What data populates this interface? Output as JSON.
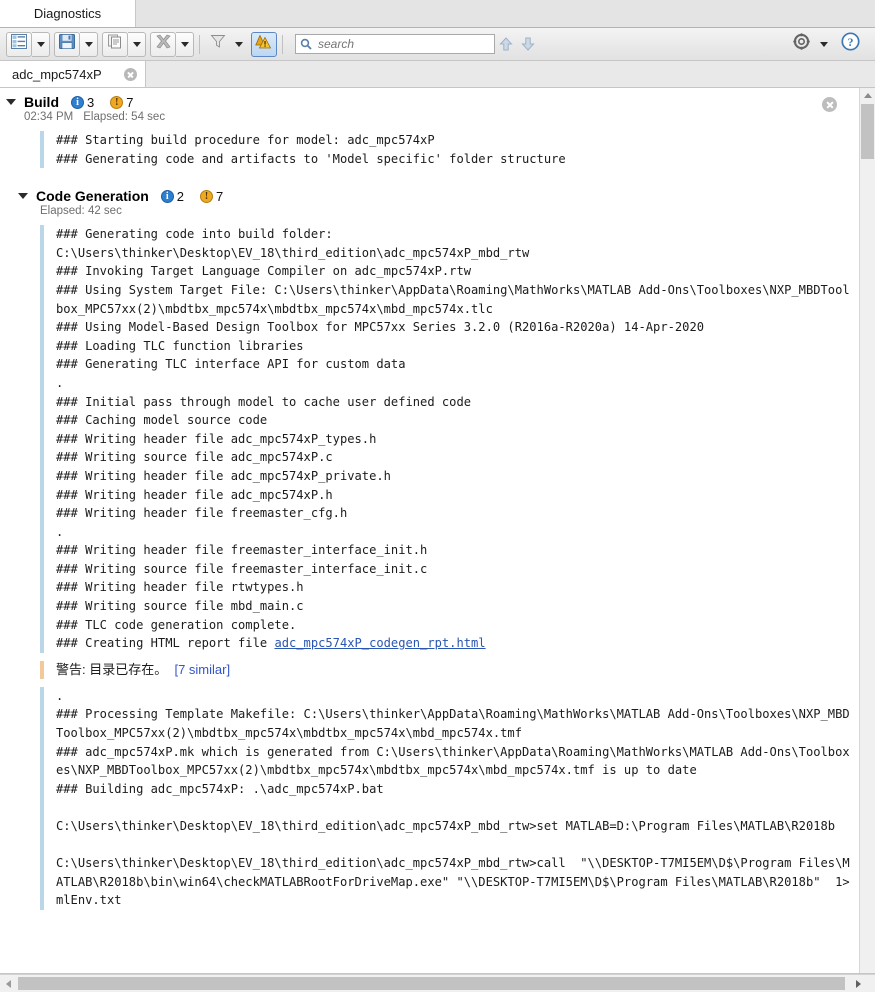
{
  "window": {
    "tab_label": "Diagnostics"
  },
  "toolbar": {
    "buttons": [
      {
        "name": "view-list-button",
        "icon": "list-view-icon",
        "has_dropdown": true,
        "active": false
      },
      {
        "name": "save-button",
        "icon": "save-disk-icon",
        "has_dropdown": true,
        "active": false
      },
      {
        "name": "copy-button",
        "icon": "copy-pages-icon",
        "has_dropdown": true,
        "active": false
      },
      {
        "name": "clear-button",
        "icon": "clear-x-icon",
        "has_dropdown": true,
        "active": false
      },
      {
        "name": "filter-button",
        "icon": "funnel-icon",
        "has_dropdown": true,
        "active": false
      },
      {
        "name": "warnings-button",
        "icon": "warnings-icon",
        "has_dropdown": false,
        "active": true
      }
    ],
    "search": {
      "placeholder": "search",
      "value": "",
      "icon": "search-icon"
    },
    "find_previous_label": "⇧",
    "find_next_label": "⇩",
    "settings_icon": "gear-icon",
    "help_icon": "help-question-icon"
  },
  "model_tab": {
    "label": "adc_mpc574xP",
    "close_icon": "close-circle-icon"
  },
  "stages": [
    {
      "title": "Build",
      "info_count": "3",
      "warn_count": "7",
      "time": "02:34 PM",
      "elapsed": "Elapsed: 54 sec",
      "messages": "### Starting build procedure for model: adc_mpc574xP\n### Generating code and artifacts to 'Model specific' folder structure"
    },
    {
      "title": "Code Generation",
      "info_count": "2",
      "warn_count": "7",
      "time": "",
      "elapsed": "Elapsed: 42 sec",
      "messages_1": "### Generating code into build folder:\nC:\\Users\\thinker\\Desktop\\EV_18\\third_edition\\adc_mpc574xP_mbd_rtw\n### Invoking Target Language Compiler on adc_mpc574xP.rtw\n### Using System Target File: C:\\Users\\thinker\\AppData\\Roaming\\MathWorks\\MATLAB Add-Ons\\Toolboxes\\NXP_MBDToolbox_MPC57xx(2)\\mbdtbx_mpc574x\\mbdtbx_mpc574x\\mbd_mpc574x.tlc\n### Using Model-Based Design Toolbox for MPC57xx Series 3.2.0 (R2016a-R2020a) 14-Apr-2020\n### Loading TLC function libraries\n### Generating TLC interface API for custom data\n.\n### Initial pass through model to cache user defined code\n### Caching model source code\n### Writing header file adc_mpc574xP_types.h\n### Writing source file adc_mpc574xP.c\n### Writing header file adc_mpc574xP_private.h\n### Writing header file adc_mpc574xP.h\n### Writing header file freemaster_cfg.h\n.\n### Writing header file freemaster_interface_init.h\n### Writing source file freemaster_interface_init.c\n### Writing header file rtwtypes.h\n### Writing source file mbd_main.c\n### TLC code generation complete.\n",
      "link_prefix": "### Creating HTML report file ",
      "link_text": "adc_mpc574xP_codegen_rpt.html",
      "warning_text": "警告: 目录已存在。",
      "warning_similar": "[7 similar]",
      "messages_2": ".\n### Processing Template Makefile: C:\\Users\\thinker\\AppData\\Roaming\\MathWorks\\MATLAB Add-Ons\\Toolboxes\\NXP_MBDToolbox_MPC57xx(2)\\mbdtbx_mpc574x\\mbdtbx_mpc574x\\mbd_mpc574x.tmf\n### adc_mpc574xP.mk which is generated from C:\\Users\\thinker\\AppData\\Roaming\\MathWorks\\MATLAB Add-Ons\\Toolboxes\\NXP_MBDToolbox_MPC57xx(2)\\mbdtbx_mpc574x\\mbdtbx_mpc574x\\mbd_mpc574x.tmf is up to date\n### Building adc_mpc574xP: .\\adc_mpc574xP.bat\n\nC:\\Users\\thinker\\Desktop\\EV_18\\third_edition\\adc_mpc574xP_mbd_rtw>set MATLAB=D:\\Program Files\\MATLAB\\R2018b\n\nC:\\Users\\thinker\\Desktop\\EV_18\\third_edition\\adc_mpc574xP_mbd_rtw>call  \"\\\\DESKTOP-T7MI5EM\\D$\\Program Files\\MATLAB\\R2018b\\bin\\win64\\checkMATLABRootForDriveMap.exe\" \"\\\\DESKTOP-T7MI5EM\\D$\\Program Files\\MATLAB\\R2018b\"  1>mlEnv.txt"
    }
  ],
  "colors": {
    "info_blue": "#2f7fd1",
    "warn_orange": "#efa81f",
    "link_blue": "#2a55b0",
    "message_bar_blue": "#b9d7e8",
    "message_bar_orange": "#f2c99a",
    "toolbar_active": "#5b87c4"
  }
}
